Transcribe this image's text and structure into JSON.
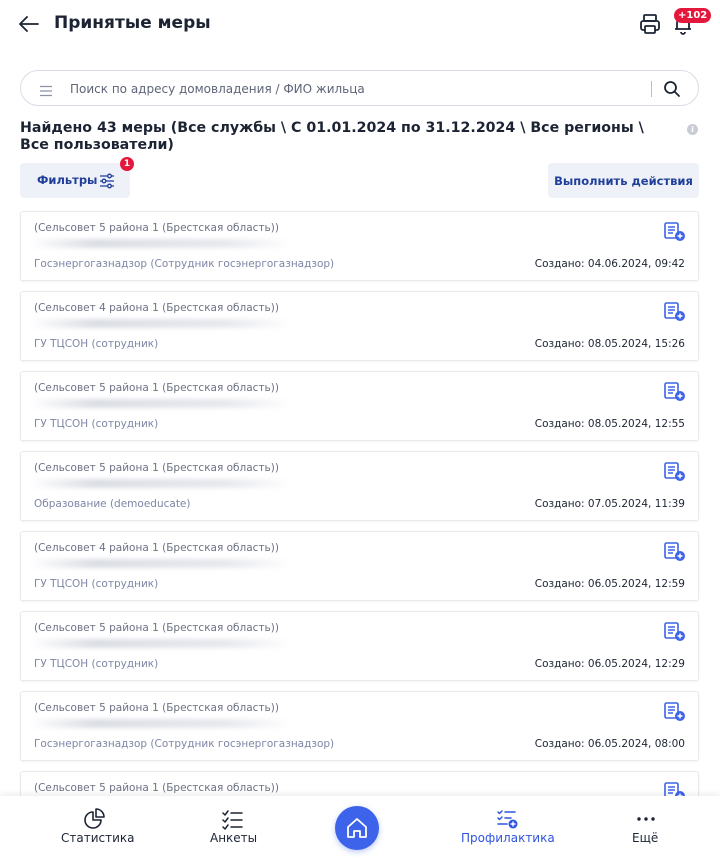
{
  "header": {
    "title": "Принятые меры",
    "notification_count": "+102"
  },
  "search": {
    "placeholder": "Поиск по адресу домовладения / ФИО жильца"
  },
  "summary": {
    "text": "Найдено 43 меры (Все службы \\ С 01.01.2024 по 31.12.2024 \\ Все регионы \\ Все пользователи)"
  },
  "toolbar": {
    "filters_label": "Фильтры",
    "filters_badge": "1",
    "actions_label": "Выполнить действия"
  },
  "cards": [
    {
      "org": "(Сельсовет 5 района 1 (Брестская область))",
      "service": "Госэнергогазнадзор (Сотрудник госэнергогазнадзор)",
      "created": "Создано: 04.06.2024, 09:42"
    },
    {
      "org": "(Сельсовет 4 района 1 (Брестская область))",
      "service": "ГУ ТЦСОН (сотрудник)",
      "created": "Создано: 08.05.2024, 15:26"
    },
    {
      "org": "(Сельсовет 5 района 1 (Брестская область))",
      "service": "ГУ ТЦСОН (сотрудник)",
      "created": "Создано: 08.05.2024, 12:55"
    },
    {
      "org": "(Сельсовет 5 района 1 (Брестская область))",
      "service": "Образование (demoeducate)",
      "created": "Создано: 07.05.2024, 11:39"
    },
    {
      "org": "(Сельсовет 4 района 1 (Брестская область))",
      "service": "ГУ ТЦСОН (сотрудник)",
      "created": "Создано: 06.05.2024, 12:59"
    },
    {
      "org": "(Сельсовет 5 района 1 (Брестская область))",
      "service": "ГУ ТЦСОН (сотрудник)",
      "created": "Создано: 06.05.2024, 12:29"
    },
    {
      "org": "(Сельсовет 5 района 1 (Брестская область))",
      "service": "Госэнергогазнадзор (Сотрудник госэнергогазнадзор)",
      "created": "Создано: 06.05.2024, 08:00"
    },
    {
      "org": "(Сельсовет 5 района 1 (Брестская область))",
      "service": "",
      "created": ""
    }
  ],
  "bottom_nav": {
    "items": [
      {
        "label": "Статистика",
        "icon": "chart-pie-icon"
      },
      {
        "label": "Анкеты",
        "icon": "checklist-icon"
      },
      {
        "label": "",
        "icon": "home-icon"
      },
      {
        "label": "Профилактика",
        "icon": "prevention-list-icon",
        "active": true
      },
      {
        "label": "Ещё",
        "icon": "more-dots-icon"
      }
    ]
  },
  "colors": {
    "accent": "#2e54e0",
    "badge": "#e4183d",
    "button_bg": "#eef1f8",
    "button_text": "#1f3f9a"
  }
}
